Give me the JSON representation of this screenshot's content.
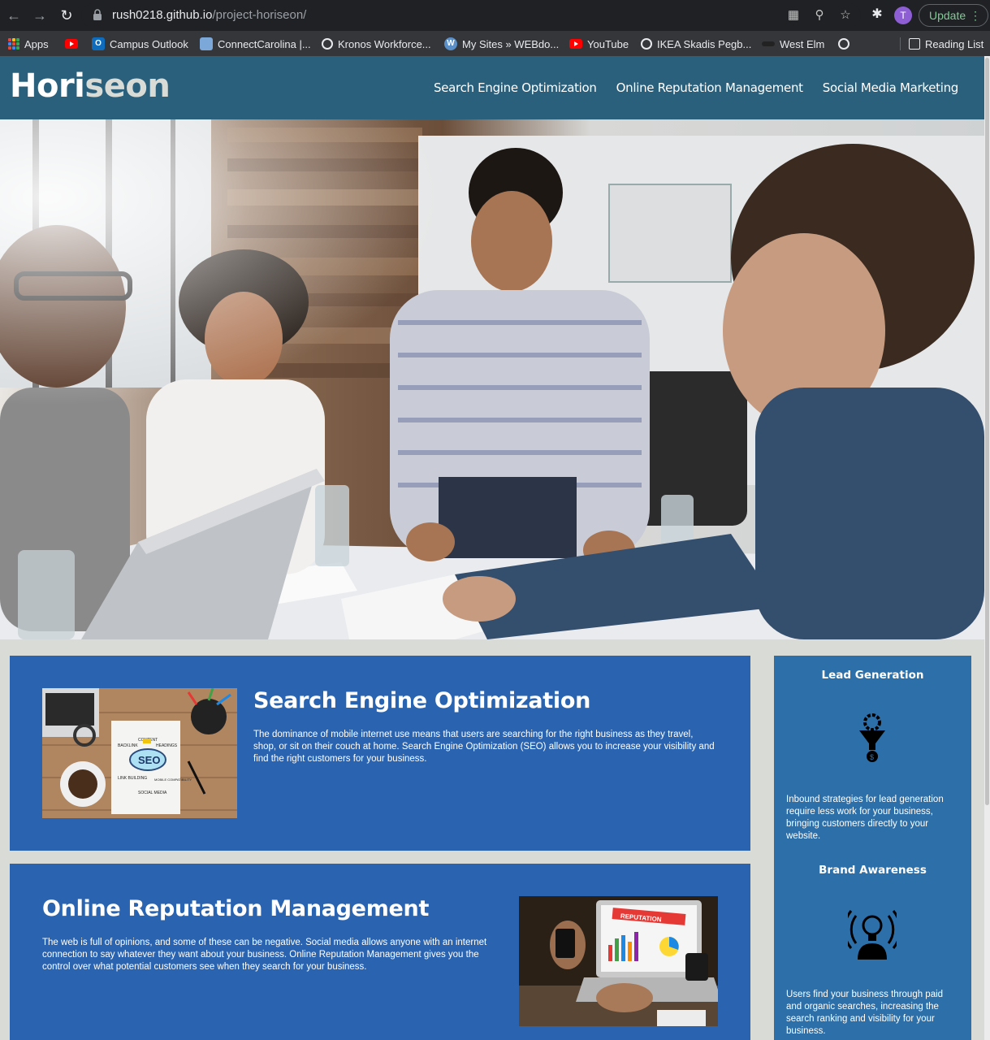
{
  "browser": {
    "url_domain": "rush0218.github.io",
    "url_path": "/project-horiseon/",
    "profile_initial": "T",
    "update_label": "Update",
    "bookmarks": [
      {
        "label": "Apps",
        "icon": "apps-grid-icon"
      },
      {
        "label": "",
        "icon": "youtube-icon"
      },
      {
        "label": "Campus Outlook",
        "icon": "outlook-icon"
      },
      {
        "label": "ConnectCarolina |...",
        "icon": "connectcarolina-icon"
      },
      {
        "label": "Kronos Workforce...",
        "icon": "globe-icon"
      },
      {
        "label": "My Sites » WEBdo...",
        "icon": "wordpress-icon"
      },
      {
        "label": "YouTube",
        "icon": "youtube-icon"
      },
      {
        "label": "IKEA Skadis Pegb...",
        "icon": "globe-icon"
      },
      {
        "label": "West Elm",
        "icon": "westelm-icon"
      },
      {
        "label": "",
        "icon": "globe-icon"
      }
    ],
    "reading_list_label": "Reading List"
  },
  "site": {
    "logo_part1": "Hori",
    "logo_part2": "seon",
    "nav": [
      {
        "label": "Search Engine Optimization"
      },
      {
        "label": "Online Reputation Management"
      },
      {
        "label": "Social Media Marketing"
      }
    ]
  },
  "content": {
    "seo": {
      "title": "Search Engine Optimization",
      "text": "The dominance of mobile internet use means that users are searching for the right business as they travel, shop, or sit on their couch at home. Search Engine Optimization (SEO) allows you to increase your visibility and find the right customers for your business.",
      "image_words": [
        "SEO",
        "CONTENT",
        "BACKLINK",
        "HEADINGS",
        "LINK BUILDING",
        "MOBILE COMPATIBILITY",
        "SOCIAL MEDIA"
      ]
    },
    "orm": {
      "title": "Online Reputation Management",
      "text": "The web is full of opinions, and some of these can be negative. Social media allows anyone with an internet connection to say whatever they want about your business. Online Reputation Management gives you the control over what potential customers see when they search for your business.",
      "image_word": "REPUTATION"
    }
  },
  "benefits": [
    {
      "title": "Lead Generation",
      "icon": "lead-funnel-icon",
      "text": "Inbound strategies for lead generation require less work for your business, bringing customers directly to your website."
    },
    {
      "title": "Brand Awareness",
      "icon": "brand-lightbulb-icon",
      "text": "Users find your business through paid and organic searches, increasing the search ranking and visibility for your business."
    }
  ],
  "colors": {
    "header": "#2a607c",
    "content_card": "#2a64b1",
    "sidebar": "#2d6fa8",
    "page_background": "#d9dcd6",
    "update_text": "#81c995"
  }
}
